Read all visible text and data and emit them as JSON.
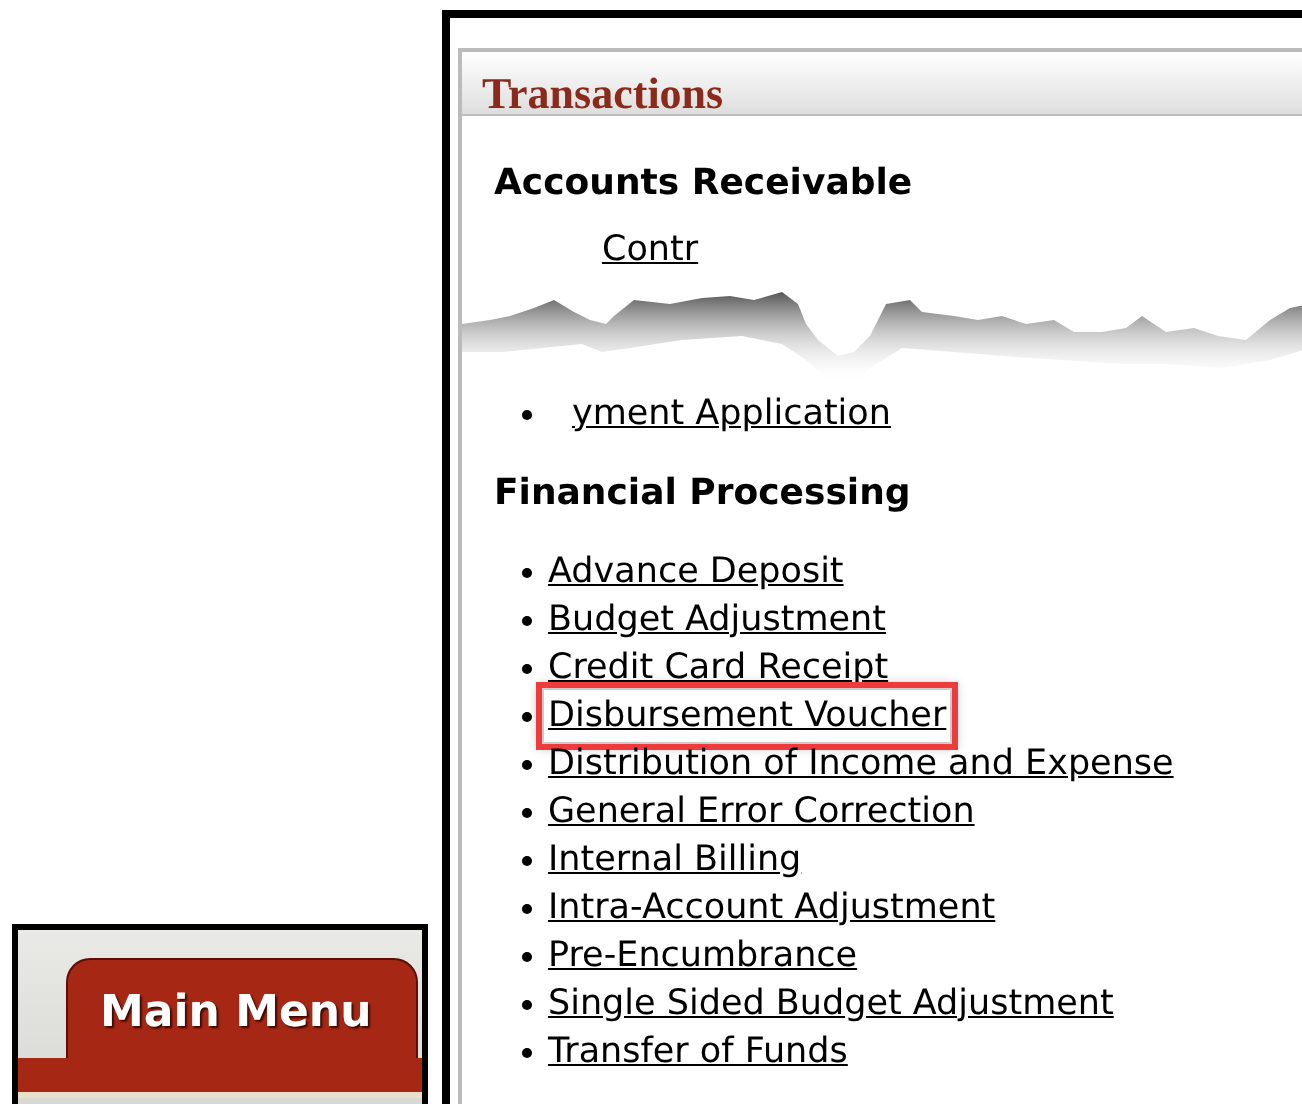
{
  "main_menu_tab": {
    "label": "Main Menu"
  },
  "panel": {
    "title": "Transactions",
    "sections": [
      {
        "heading": "Accounts Receivable",
        "torn": true,
        "items": [
          {
            "label": "Contr",
            "kind": "fragment",
            "highlighted": false
          },
          {
            "label": "yment Application",
            "kind": "fragment",
            "highlighted": false
          }
        ]
      },
      {
        "heading": "Financial Processing",
        "items": [
          {
            "label": "Advance Deposit",
            "kind": "link",
            "highlighted": false
          },
          {
            "label": "Budget Adjustment",
            "kind": "link",
            "highlighted": false
          },
          {
            "label": "Credit Card Receipt",
            "kind": "link",
            "highlighted": false
          },
          {
            "label": "Disbursement Voucher",
            "kind": "link",
            "highlighted": true
          },
          {
            "label": "Distribution of Income and Expense",
            "kind": "link",
            "highlighted": false
          },
          {
            "label": "General Error Correction",
            "kind": "link",
            "highlighted": false
          },
          {
            "label": "Internal Billing",
            "kind": "link",
            "highlighted": false
          },
          {
            "label": "Intra-Account Adjustment",
            "kind": "link",
            "highlighted": false
          },
          {
            "label": "Pre-Encumbrance",
            "kind": "link",
            "highlighted": false
          },
          {
            "label": "Single Sided Budget Adjustment",
            "kind": "link",
            "highlighted": false
          },
          {
            "label": "Transfer of Funds",
            "kind": "link",
            "highlighted": false
          }
        ]
      }
    ]
  }
}
